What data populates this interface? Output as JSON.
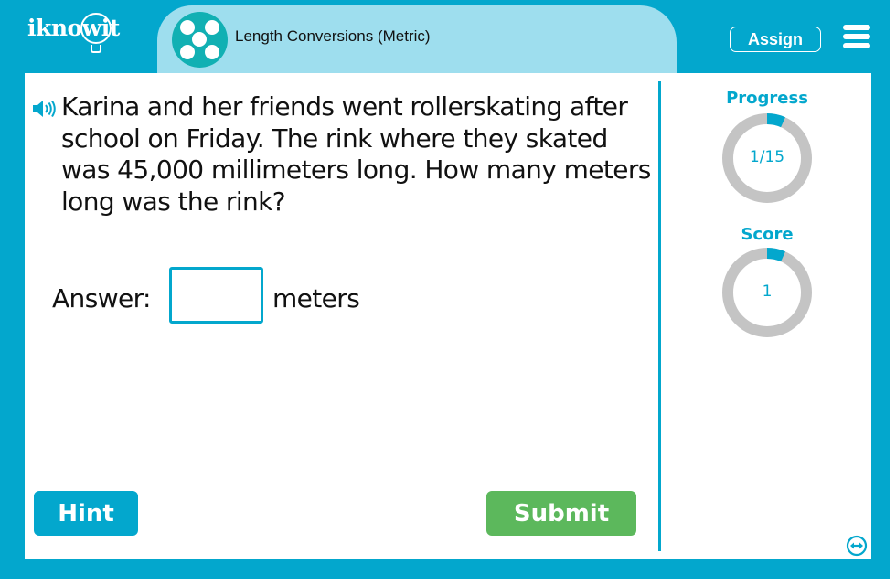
{
  "header": {
    "logo_text": "iknowit",
    "topic_title": "Length Conversions (Metric)",
    "topic_icon": "dice-five-icon",
    "assign_label": "Assign",
    "menu_icon": "hamburger-menu-icon"
  },
  "question": {
    "audio_icon": "speaker-icon",
    "text": "Karina and her friends went rollerskating after school on Friday. The rink where they skated was 45,000 millimeters long. How many meters long was the rink?"
  },
  "answer": {
    "label": "Answer:",
    "value": "",
    "placeholder": "",
    "unit": "meters"
  },
  "buttons": {
    "hint_label": "Hint",
    "submit_label": "Submit"
  },
  "sidebar": {
    "progress": {
      "title": "Progress",
      "display": "1/15",
      "current": 1,
      "total": 15,
      "fraction": 0.0667
    },
    "score": {
      "title": "Score",
      "display": "1",
      "fraction": 0.0667
    },
    "expand_icon": "expand-horizontal-icon"
  },
  "colors": {
    "brand": "#03a7cd",
    "topic_bg": "#9edeee",
    "topic_icon": "#11b0b3",
    "submit": "#5cb85c",
    "ring_track": "#c4c4c4"
  }
}
